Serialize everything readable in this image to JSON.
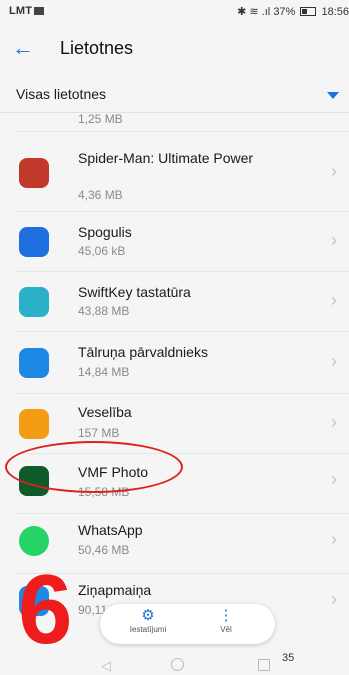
{
  "status_bar": {
    "carrier": "LMT",
    "right_text": "37%",
    "time": "18:56"
  },
  "app_bar": {
    "title": "Lietotnes"
  },
  "filter": {
    "label": "Visas lietotnes"
  },
  "partial_size": "1,25 MB",
  "apps": [
    {
      "name": "Spider-Man: Ultimate Power",
      "size": "4,36 MB",
      "color": "#c0392b"
    },
    {
      "name": "Spogulis",
      "size": "45,06 kB",
      "color": "#1e6fe0"
    },
    {
      "name": "SwiftKey tastatūra",
      "size": "43,88 MB",
      "color": "#2bb0c9"
    },
    {
      "name": "Tālruņa pārvaldnieks",
      "size": "14,84 MB",
      "color": "#1e88e5"
    },
    {
      "name": "Veselība",
      "size": "157 MB",
      "color": "#f39c12"
    },
    {
      "name": "VMF Photo",
      "size": "15,58 MB",
      "color": "#0f5b2a"
    },
    {
      "name": "WhatsApp",
      "size": "50,46 MB",
      "color": "#25d366"
    },
    {
      "name": "Ziņapmaiņa",
      "size": "90,11 kB",
      "color": "#1e88e5"
    }
  ],
  "annotation": {
    "number": "6",
    "highlight_color": "#e02020"
  },
  "bottom_actions": {
    "settings_label": "Iestatījumi",
    "more_label": "Vēl"
  },
  "nav": {
    "page_number": "35"
  }
}
